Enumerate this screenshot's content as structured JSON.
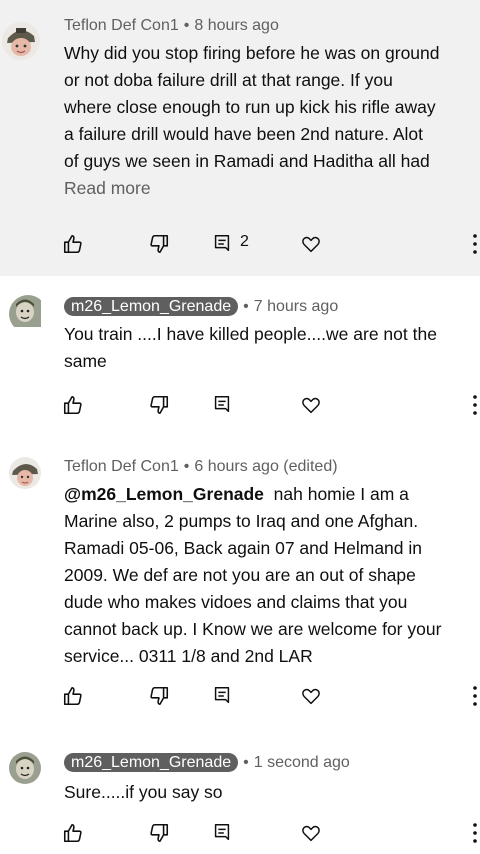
{
  "comments": [
    {
      "author": "Teflon Def Con1",
      "author_style": "plain",
      "time": "8 hours ago",
      "lines": [
        "Why did you stop firing before he was on ground",
        "or not doba failure drill at that range. If you",
        "where close enough to run up kick his rifle away",
        "a failure drill would have been 2nd nature. Alot",
        "of guys we seen in Ramadi and Haditha all had"
      ],
      "read_more": "Read more",
      "reply_count": "2",
      "highlighted": true
    },
    {
      "author": "m26_Lemon_Grenade",
      "author_style": "chip",
      "time": "7 hours ago",
      "lines": [
        "You train ....I have killed people....we are not the",
        "same"
      ]
    },
    {
      "author": "Teflon Def Con1",
      "author_style": "plain",
      "time": "6 hours ago (edited)",
      "mention": "@m26_Lemon_Grenade",
      "first_line_rest": "  nah homie I am a",
      "lines": [
        "Marine also,  2 pumps to Iraq and one Afghan.",
        "Ramadi 05-06, Back again 07 and Helmand in",
        "2009.  We def are not you are an out of shape",
        "dude who makes vidoes and claims that you",
        "cannot back up. I Know we are welcome for your",
        "service... 0311 1/8 and 2nd LAR"
      ]
    },
    {
      "author": "m26_Lemon_Grenade",
      "author_style": "chip",
      "time": "1 second ago",
      "lines": [
        "Sure.....if you say so"
      ]
    }
  ],
  "icons": {
    "like": "thumbs-up-icon",
    "dislike": "thumbs-down-icon",
    "reply": "reply-icon",
    "heart": "heart-icon",
    "more": "more-vertical-icon"
  },
  "colors": {
    "highlight_bg": "#f1f1f1",
    "meta_text": "#606060",
    "chip_bg": "#5f5f5f"
  }
}
